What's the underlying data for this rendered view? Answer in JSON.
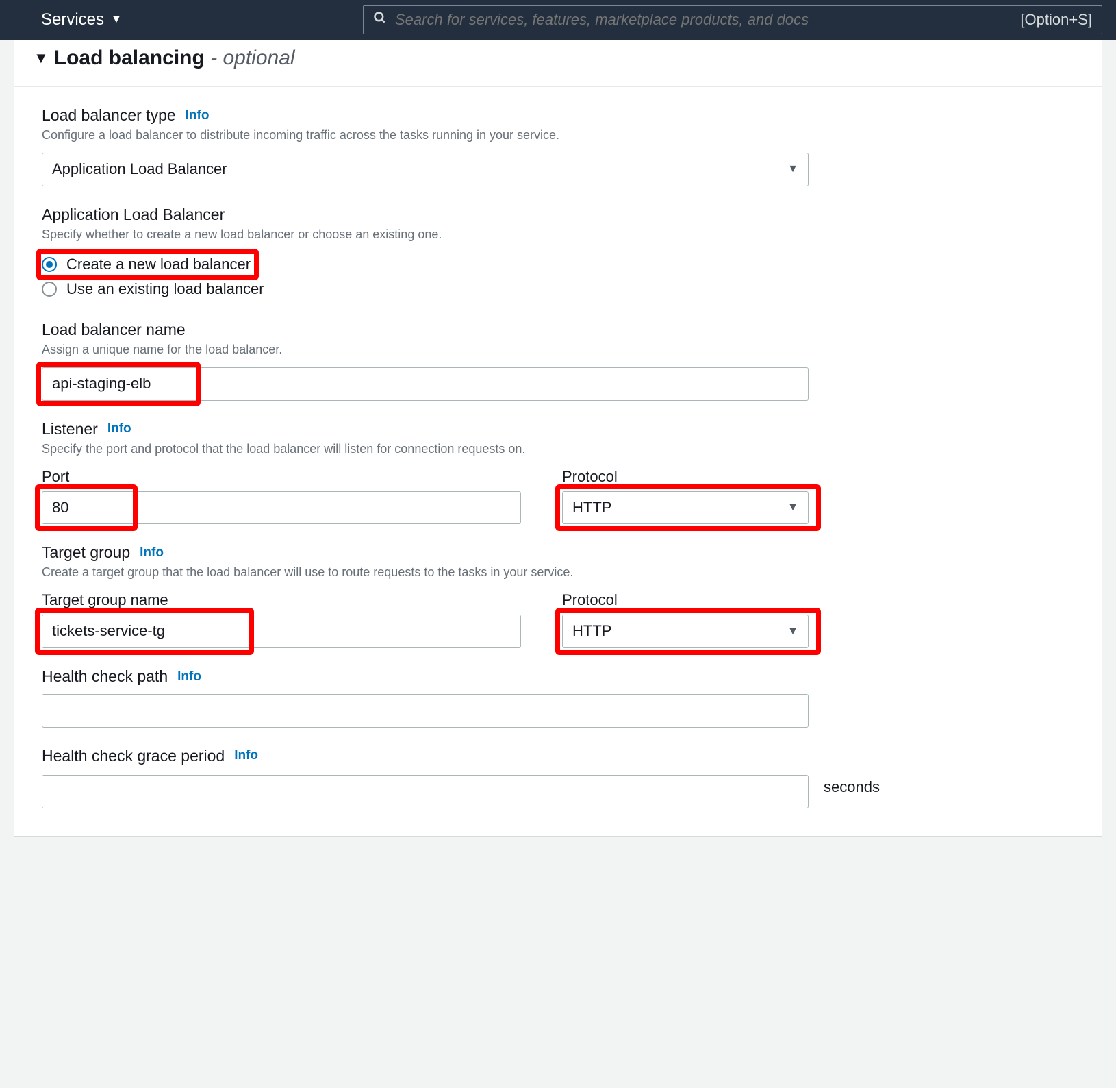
{
  "topbar": {
    "services_label": "Services",
    "search_placeholder": "Search for services, features, marketplace products, and docs",
    "shortcut": "[Option+S]"
  },
  "panel": {
    "title": "Load balancing",
    "optional_suffix": "- optional"
  },
  "lb_type": {
    "label": "Load balancer type",
    "info": "Info",
    "desc": "Configure a load balancer to distribute incoming traffic across the tasks running in your service.",
    "selected": "Application Load Balancer"
  },
  "alb": {
    "label": "Application Load Balancer",
    "desc": "Specify whether to create a new load balancer or choose an existing one.",
    "options": {
      "create": "Create a new load balancer",
      "existing": "Use an existing load balancer"
    }
  },
  "lb_name": {
    "label": "Load balancer name",
    "desc": "Assign a unique name for the load balancer.",
    "value": "api-staging-elb"
  },
  "listener": {
    "label": "Listener",
    "info": "Info",
    "desc": "Specify the port and protocol that the load balancer will listen for connection requests on.",
    "port_label": "Port",
    "port_value": "80",
    "protocol_label": "Protocol",
    "protocol_value": "HTTP"
  },
  "target_group": {
    "label": "Target group",
    "info": "Info",
    "desc": "Create a target group that the load balancer will use to route requests to the tasks in your service.",
    "name_label": "Target group name",
    "name_value": "tickets-service-tg",
    "protocol_label": "Protocol",
    "protocol_value": "HTTP"
  },
  "health_path": {
    "label": "Health check path",
    "info": "Info",
    "value": ""
  },
  "health_grace": {
    "label": "Health check grace period",
    "info": "Info",
    "value": "",
    "unit": "seconds"
  }
}
